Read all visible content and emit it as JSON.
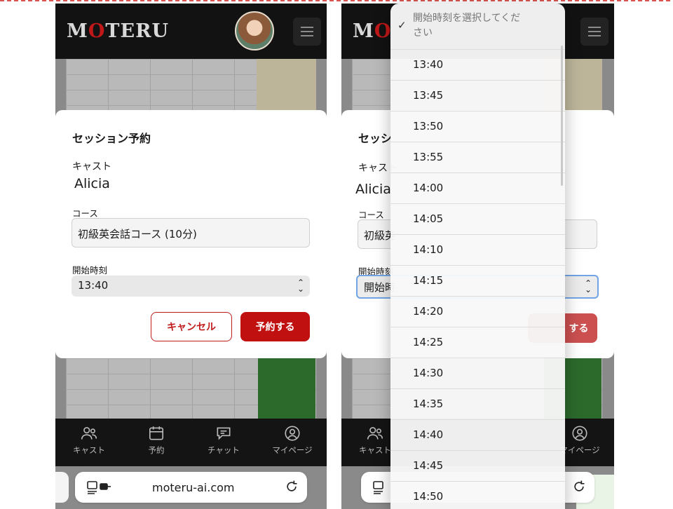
{
  "app": {
    "logo_text_a": "M",
    "logo_text_o": "O",
    "logo_text_b": "TERU",
    "brand_red": "#c01010"
  },
  "modal": {
    "title": "セッション予約",
    "cast_label": "キャスト",
    "cast_name": "Alicia",
    "course_label": "コース",
    "course_value": "初級英会話コース (10分)",
    "start_time_label": "開始時刻",
    "start_time_value": "13:40",
    "start_time_value_right": "開始時",
    "course_value_right": "初級英",
    "title_right": "セッシ",
    "cancel_label": "キャンセル",
    "book_label": "予約する",
    "book_label_right": "する"
  },
  "nav": {
    "items": [
      {
        "label": "キャスト",
        "icon": "users-icon"
      },
      {
        "label": "予約",
        "icon": "calendar-icon"
      },
      {
        "label": "チャット",
        "icon": "chat-icon"
      },
      {
        "label": "マイページ",
        "icon": "user-circle-icon"
      }
    ],
    "right_first": "キャスト",
    "right_last": "マイページ"
  },
  "browser": {
    "url": "moteru-ai.com"
  },
  "dropdown": {
    "placeholder": "開始時刻を選択してください",
    "options": [
      "13:40",
      "13:45",
      "13:50",
      "13:55",
      "14:00",
      "14:05",
      "14:10",
      "14:15",
      "14:20",
      "14:25",
      "14:30",
      "14:35",
      "14:40",
      "14:45",
      "14:50"
    ]
  }
}
